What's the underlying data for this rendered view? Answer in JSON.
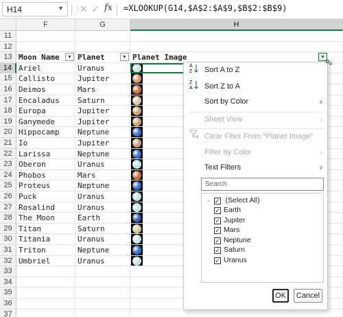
{
  "formula_bar": {
    "name_box": "H14",
    "formula": "=XLOOKUP(G14,$A$2:$A$9,$B$2:$B$9)",
    "icons": [
      "more-icon",
      "cancel-icon",
      "enter-icon",
      "fx-icon"
    ]
  },
  "columns": {
    "f": "F",
    "g": "G",
    "h": "H"
  },
  "header_row": {
    "num": "13",
    "moon": "Moon Name",
    "planet": "Planet",
    "image": "Planet Image"
  },
  "blank_rows_top": [
    {
      "num": "11"
    },
    {
      "num": "12"
    }
  ],
  "rows": [
    {
      "num": "14",
      "moon": "Ariel",
      "planet": "Uranus",
      "color": "#c5e4e8"
    },
    {
      "num": "15",
      "moon": "Callisto",
      "planet": "Jupiter",
      "color": "#c9a37a"
    },
    {
      "num": "16",
      "moon": "Deimos",
      "planet": "Mars",
      "color": "#c8704a"
    },
    {
      "num": "17",
      "moon": "Encaladus",
      "planet": "Saturn",
      "color": "#d9c9a0"
    },
    {
      "num": "18",
      "moon": "Europa",
      "planet": "Jupiter",
      "color": "#c9a37a"
    },
    {
      "num": "19",
      "moon": "Ganymede",
      "planet": "Jupiter",
      "color": "#c9a37a"
    },
    {
      "num": "20",
      "moon": "Hippocamp",
      "planet": "Neptune",
      "color": "#3f6fc4"
    },
    {
      "num": "21",
      "moon": "Io",
      "planet": "Jupiter",
      "color": "#c9a37a"
    },
    {
      "num": "22",
      "moon": "Larissa",
      "planet": "Neptune",
      "color": "#3f6fc4"
    },
    {
      "num": "23",
      "moon": "Oberon",
      "planet": "Uranus",
      "color": "#c5e4e8"
    },
    {
      "num": "24",
      "moon": "Phobos",
      "planet": "Mars",
      "color": "#c8704a"
    },
    {
      "num": "25",
      "moon": "Proteus",
      "planet": "Neptune",
      "color": "#3f6fc4"
    },
    {
      "num": "26",
      "moon": "Puck",
      "planet": "Uranus",
      "color": "#c5e4e8"
    },
    {
      "num": "27",
      "moon": "Rosalind",
      "planet": "Uranus",
      "color": "#c5e4e8"
    },
    {
      "num": "28",
      "moon": "The Moon",
      "planet": "Earth",
      "color": "#3a5fa8"
    },
    {
      "num": "29",
      "moon": "Titan",
      "planet": "Saturn",
      "color": "#d9c9a0"
    },
    {
      "num": "30",
      "moon": "Titania",
      "planet": "Uranus",
      "color": "#c5e4e8"
    },
    {
      "num": "31",
      "moon": "Triton",
      "planet": "Neptune",
      "color": "#3f6fc4"
    },
    {
      "num": "32",
      "moon": "Umbriel",
      "planet": "Uranus",
      "color": "#c5e4e8"
    }
  ],
  "blank_rows_bottom": [
    {
      "num": "33"
    },
    {
      "num": "34"
    },
    {
      "num": "35"
    },
    {
      "num": "36"
    },
    {
      "num": "37"
    }
  ],
  "filter_menu": {
    "sort_az": "Sort A to Z",
    "sort_za": "Sort Z to A",
    "sort_by_color": "Sort by Color",
    "sheet_view": "Sheet View",
    "clear_filter": "Clear Filter From \"Planet Image\"",
    "filter_by_color": "Filter by Color",
    "text_filters": "Text Filters",
    "search_placeholder": "Search",
    "select_all": "(Select All)",
    "values": [
      "Earth",
      "Jupiter",
      "Mars",
      "Neptune",
      "Saturn",
      "Uranus"
    ],
    "ok": "OK",
    "cancel": "Cancel"
  },
  "colors": {
    "accent": "#217346",
    "selected_header": "#d2d2d2"
  }
}
